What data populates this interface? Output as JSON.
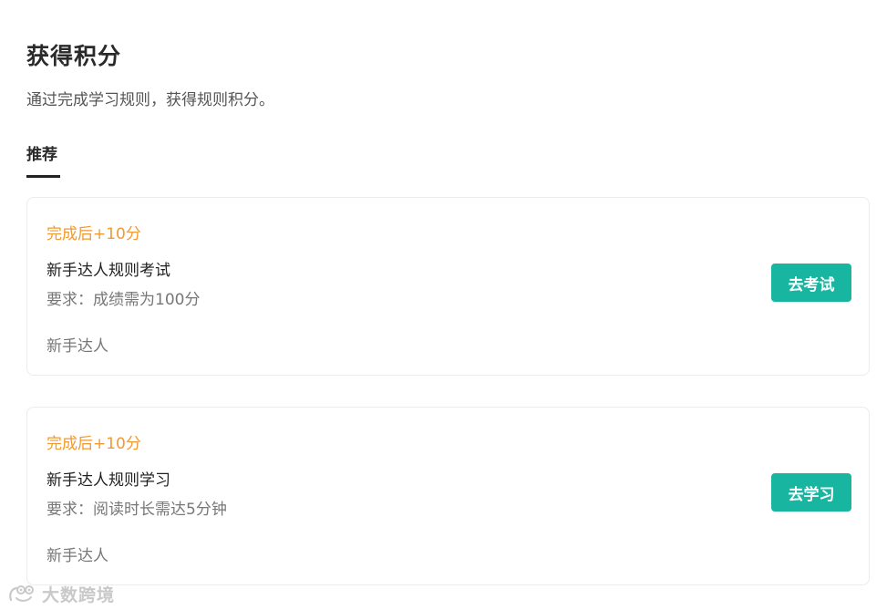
{
  "header": {
    "title": "获得积分",
    "subtitle": "通过完成学习规则，获得规则积分。"
  },
  "tabs": [
    {
      "label": "推荐",
      "active": true
    }
  ],
  "cards": [
    {
      "reward": "完成后+10分",
      "title": "新手达人规则考试",
      "requirement": "要求：成绩需为100分",
      "tag": "新手达人",
      "button_label": "去考试"
    },
    {
      "reward": "完成后+10分",
      "title": "新手达人规则学习",
      "requirement": "要求：阅读时长需达5分钟",
      "tag": "新手达人",
      "button_label": "去学习"
    }
  ],
  "watermark": {
    "text": "大数跨境",
    "icon": "eye-logo-icon"
  },
  "colors": {
    "accent": "#18b5a0",
    "reward": "#ef9a33",
    "title": "#2a2a2a",
    "secondary_text": "#777777"
  }
}
